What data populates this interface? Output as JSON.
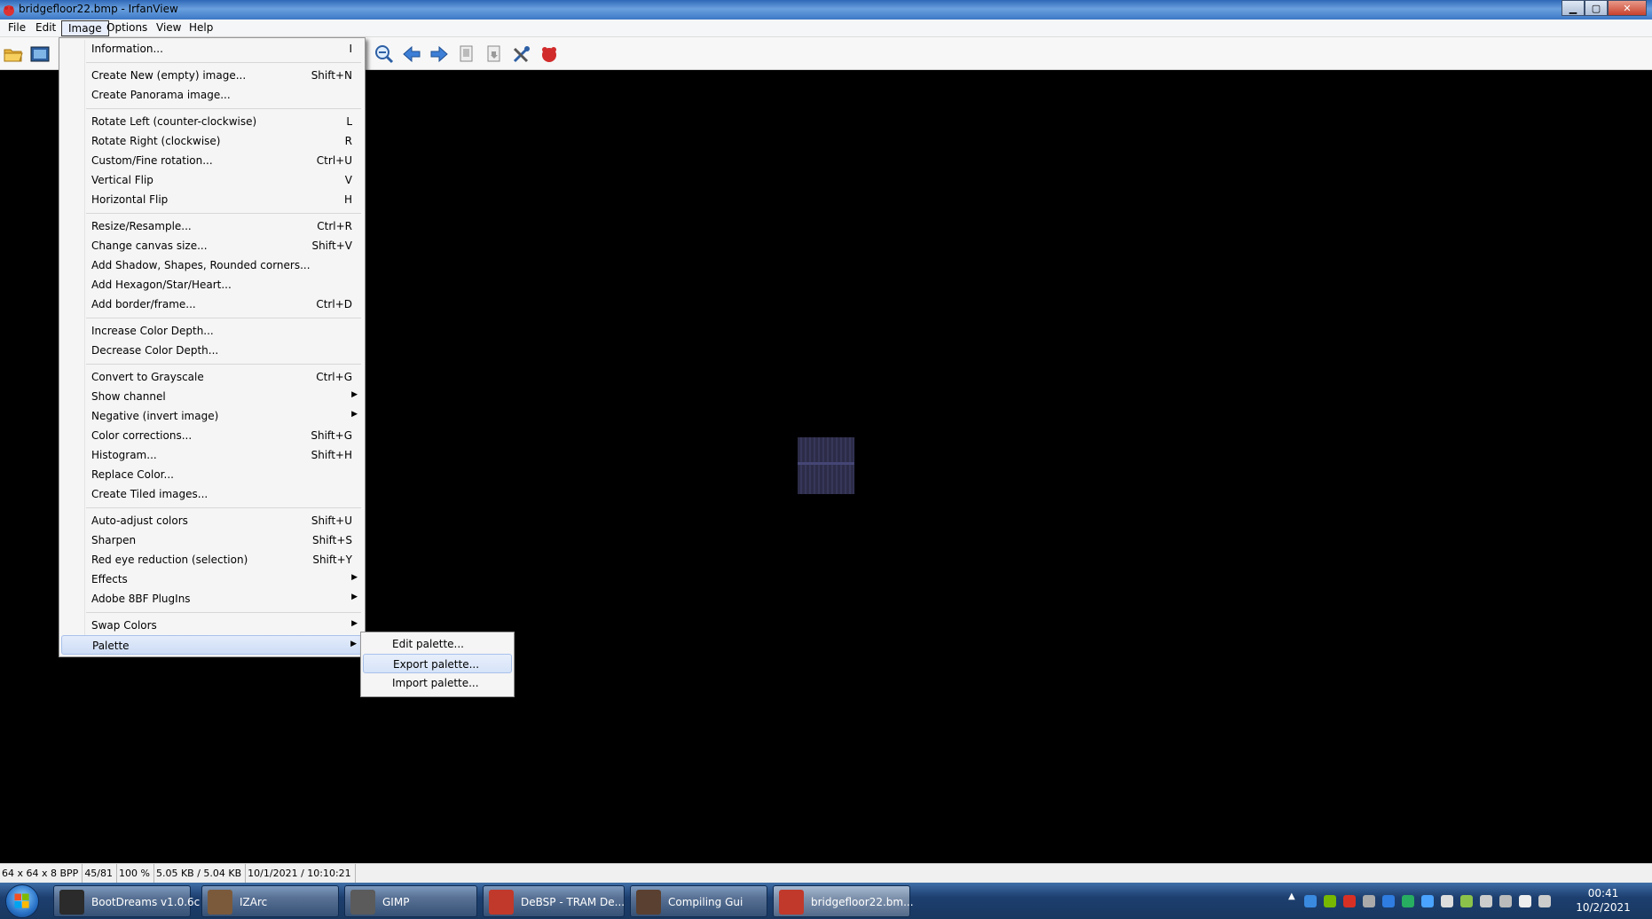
{
  "window": {
    "title": "bridgefloor22.bmp - IrfanView"
  },
  "menubar": {
    "items": [
      {
        "label": "File"
      },
      {
        "label": "Edit"
      },
      {
        "label": "Image"
      },
      {
        "label": "Options"
      },
      {
        "label": "View"
      },
      {
        "label": "Help"
      }
    ],
    "active": "Image"
  },
  "toolbar": {
    "icons": [
      "open-folder-icon",
      "thumbnails-icon",
      "zoom-out-icon",
      "previous-arrow-icon",
      "next-arrow-icon",
      "copy-icon",
      "paste-icon",
      "properties-tools-icon",
      "irfanview-about-icon"
    ]
  },
  "image_menu": {
    "items": [
      {
        "label": "Information...",
        "shortcut": "I"
      },
      {
        "label": "Create New (empty) image...",
        "shortcut": "Shift+N"
      },
      {
        "label": "Create Panorama image...",
        "shortcut": ""
      },
      {
        "label": "Rotate Left (counter-clockwise)",
        "shortcut": "L"
      },
      {
        "label": "Rotate Right (clockwise)",
        "shortcut": "R"
      },
      {
        "label": "Custom/Fine rotation...",
        "shortcut": "Ctrl+U"
      },
      {
        "label": "Vertical Flip",
        "shortcut": "V"
      },
      {
        "label": "Horizontal Flip",
        "shortcut": "H"
      },
      {
        "label": "Resize/Resample...",
        "shortcut": "Ctrl+R"
      },
      {
        "label": "Change canvas size...",
        "shortcut": "Shift+V"
      },
      {
        "label": "Add Shadow, Shapes, Rounded corners...",
        "shortcut": ""
      },
      {
        "label": "Add Hexagon/Star/Heart...",
        "shortcut": ""
      },
      {
        "label": "Add border/frame...",
        "shortcut": "Ctrl+D"
      },
      {
        "label": "Increase Color Depth...",
        "shortcut": ""
      },
      {
        "label": "Decrease Color Depth...",
        "shortcut": ""
      },
      {
        "label": "Convert to Grayscale",
        "shortcut": "Ctrl+G"
      },
      {
        "label": "Show channel",
        "shortcut": ""
      },
      {
        "label": "Negative (invert image)",
        "shortcut": ""
      },
      {
        "label": "Color corrections...",
        "shortcut": "Shift+G"
      },
      {
        "label": "Histogram...",
        "shortcut": "Shift+H"
      },
      {
        "label": "Replace Color...",
        "shortcut": ""
      },
      {
        "label": "Create Tiled images...",
        "shortcut": ""
      },
      {
        "label": "Auto-adjust colors",
        "shortcut": "Shift+U"
      },
      {
        "label": "Sharpen",
        "shortcut": "Shift+S"
      },
      {
        "label": "Red eye reduction (selection)",
        "shortcut": "Shift+Y"
      },
      {
        "label": "Effects",
        "shortcut": ""
      },
      {
        "label": "Adobe 8BF PlugIns",
        "shortcut": ""
      },
      {
        "label": "Swap Colors",
        "shortcut": ""
      },
      {
        "label": "Palette",
        "shortcut": ""
      }
    ]
  },
  "palette_menu": {
    "items": [
      {
        "label": "Edit palette..."
      },
      {
        "label": "Export palette..."
      },
      {
        "label": "Import palette..."
      }
    ],
    "highlighted": "Export palette..."
  },
  "statusbar": {
    "cells": [
      "64 x 64 x 8 BPP",
      "45/81",
      "100 %",
      "5.05 KB / 5.04 KB",
      "10/1/2021 / 10:10:21"
    ]
  },
  "taskbar": {
    "tasks": [
      {
        "label": "BootDreams v1.0.6c",
        "icon": "bootdreams-icon",
        "color": "#2b2b2b"
      },
      {
        "label": "IZArc",
        "icon": "izarc-icon",
        "color": "#7b5a3c"
      },
      {
        "label": "GIMP",
        "icon": "gimp-icon",
        "color": "#5b5b5b"
      },
      {
        "label": "DeBSP - TRAM De...",
        "icon": "debsp-icon",
        "color": "#c0392b"
      },
      {
        "label": "Compiling Gui",
        "icon": "compiling-gui-icon",
        "color": "#5a4030"
      },
      {
        "label": "bridgefloor22.bm...",
        "icon": "irfanview-icon",
        "color": "#c0392b"
      }
    ],
    "clock": {
      "time": "00:41",
      "date": "10/2/2021"
    }
  },
  "colors": {
    "menu_bg": "#f5f5f5",
    "highlight_border": "#a8c1ea",
    "canvas": "#000000",
    "taskbar": "#1d3f6f"
  }
}
